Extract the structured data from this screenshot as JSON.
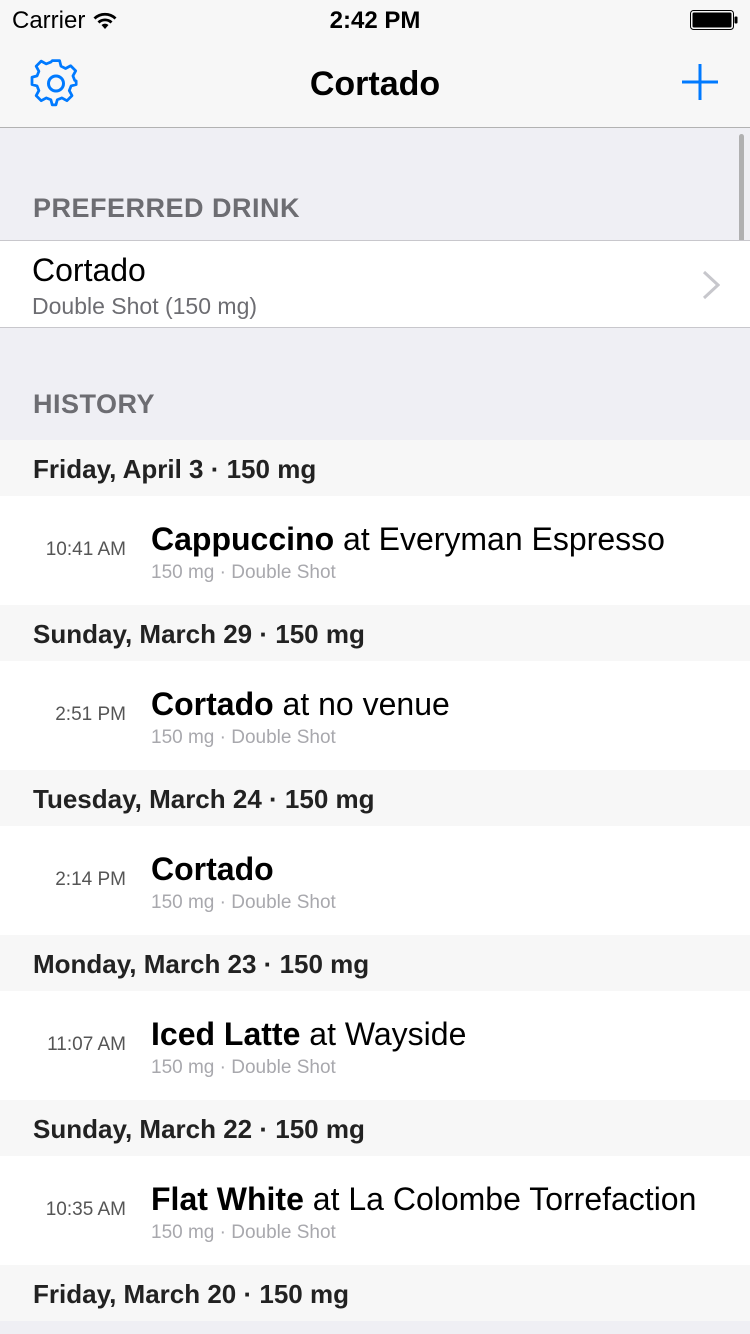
{
  "status_bar": {
    "carrier": "Carrier",
    "time": "2:42 PM"
  },
  "nav": {
    "title": "Cortado",
    "settings_icon": "gear-icon",
    "add_icon": "plus-icon",
    "accent_color": "#007aff"
  },
  "preferred": {
    "section_title": "PREFERRED DRINK",
    "drink_name": "Cortado",
    "drink_detail": "Double Shot (150 mg)"
  },
  "history": {
    "section_title": "HISTORY",
    "days": [
      {
        "header": "Friday, April 3 · 150 mg",
        "entries": [
          {
            "time": "10:41 AM",
            "drink": "Cappuccino",
            "venue": " at Everyman Espresso",
            "detail": "150 mg · Double Shot"
          }
        ]
      },
      {
        "header": "Sunday, March 29 · 150 mg",
        "entries": [
          {
            "time": "2:51 PM",
            "drink": "Cortado",
            "venue": " at no venue",
            "detail": "150 mg · Double Shot"
          }
        ]
      },
      {
        "header": "Tuesday, March 24 · 150 mg",
        "entries": [
          {
            "time": "2:14 PM",
            "drink": "Cortado",
            "venue": "",
            "detail": "150 mg · Double Shot"
          }
        ]
      },
      {
        "header": "Monday, March 23 · 150 mg",
        "entries": [
          {
            "time": "11:07 AM",
            "drink": "Iced Latte",
            "venue": " at Wayside",
            "detail": "150 mg · Double Shot"
          }
        ]
      },
      {
        "header": "Sunday, March 22 · 150 mg",
        "entries": [
          {
            "time": "10:35 AM",
            "drink": "Flat White",
            "venue": " at La Colombe Torrefaction",
            "detail": "150 mg · Double Shot"
          }
        ]
      },
      {
        "header": "Friday, March 20 · 150 mg",
        "entries": []
      }
    ]
  }
}
